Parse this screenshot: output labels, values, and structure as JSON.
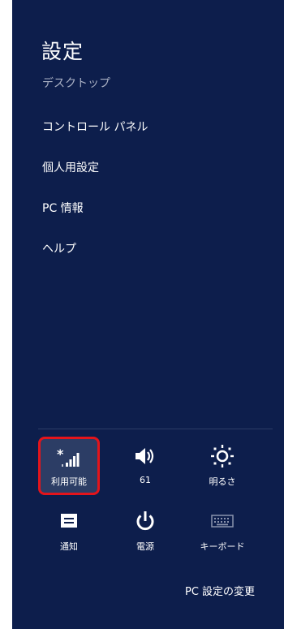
{
  "charm": {
    "title": "設定",
    "subtitle": "デスクトップ",
    "menu": [
      {
        "label": "コントロール パネル"
      },
      {
        "label": "個人用設定"
      },
      {
        "label": "PC 情報"
      },
      {
        "label": "ヘルプ"
      }
    ]
  },
  "quick_settings": {
    "network": {
      "label": "利用可能",
      "icon": "network-available-icon"
    },
    "volume": {
      "label": "61",
      "icon": "speaker-icon"
    },
    "brightness": {
      "label": "明るさ",
      "icon": "sun-icon"
    },
    "notifications": {
      "label": "通知",
      "icon": "notification-icon"
    },
    "power": {
      "label": "電源",
      "icon": "power-icon"
    },
    "keyboard": {
      "label": "キーボード",
      "icon": "keyboard-icon"
    }
  },
  "footer": {
    "change_pc_settings": "PC 設定の変更"
  },
  "colors": {
    "background": "#0d1e4c",
    "highlight_border": "#e3141b",
    "selected_tile": "#2c3d65"
  }
}
